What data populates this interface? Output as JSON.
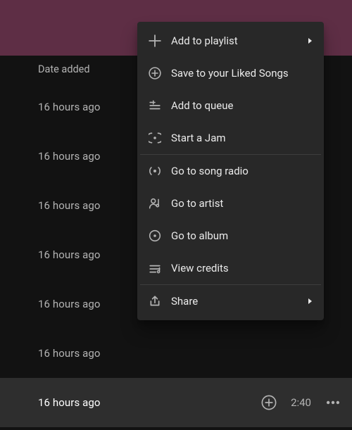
{
  "header": {
    "date_column_label": "Date added"
  },
  "tracks": [
    {
      "date": "16 hours ago"
    },
    {
      "date": "16 hours ago"
    },
    {
      "date": "16 hours ago"
    },
    {
      "date": "16 hours ago"
    },
    {
      "date": "16 hours ago"
    },
    {
      "date": "16 hours ago"
    },
    {
      "date": "16 hours ago",
      "hovered": true,
      "duration": "2:40"
    }
  ],
  "context_menu": {
    "items": [
      {
        "icon": "plus-icon",
        "label": "Add to playlist",
        "submenu": true
      },
      {
        "icon": "save-liked-icon",
        "label": "Save to your Liked Songs",
        "submenu": false
      },
      {
        "icon": "queue-icon",
        "label": "Add to queue",
        "submenu": false
      },
      {
        "icon": "jam-icon",
        "label": "Start a Jam",
        "submenu": false
      },
      {
        "separator": true
      },
      {
        "icon": "radio-icon",
        "label": "Go to song radio",
        "submenu": false
      },
      {
        "icon": "artist-icon",
        "label": "Go to artist",
        "submenu": false
      },
      {
        "icon": "album-icon",
        "label": "Go to album",
        "submenu": false
      },
      {
        "icon": "credits-icon",
        "label": "View credits",
        "submenu": false
      },
      {
        "separator": true
      },
      {
        "icon": "share-icon",
        "label": "Share",
        "submenu": true
      }
    ]
  }
}
